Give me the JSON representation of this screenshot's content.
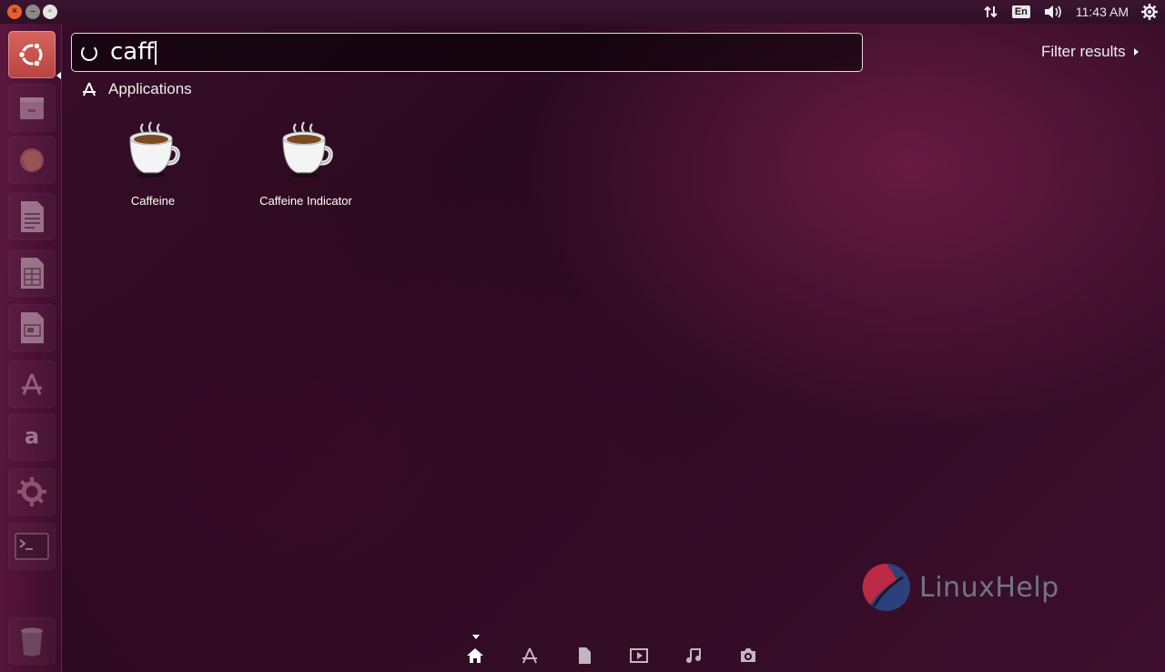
{
  "top_panel": {
    "keyboard_layout": "En",
    "clock": "11:43 AM",
    "window_buttons": [
      "close",
      "minimize",
      "maximize"
    ]
  },
  "launcher": {
    "items": [
      {
        "name": "ubuntu-dash",
        "icon": "ubuntu-logo-icon",
        "active": true
      },
      {
        "name": "files",
        "icon": "file-cabinet-icon"
      },
      {
        "name": "firefox",
        "icon": "firefox-icon"
      },
      {
        "name": "writer",
        "icon": "document-icon"
      },
      {
        "name": "calc",
        "icon": "spreadsheet-icon"
      },
      {
        "name": "impress",
        "icon": "presentation-icon"
      },
      {
        "name": "software-center",
        "icon": "software-center-icon"
      },
      {
        "name": "amazon",
        "icon": "amazon-icon"
      },
      {
        "name": "system-settings",
        "icon": "settings-icon"
      },
      {
        "name": "terminal",
        "icon": "terminal-icon"
      },
      {
        "name": "trash",
        "icon": "trash-icon"
      }
    ]
  },
  "search": {
    "query": "caff"
  },
  "filter": {
    "label": "Filter results"
  },
  "results": {
    "category": "Applications",
    "apps": [
      {
        "label": "Caffeine",
        "icon": "coffee-cup-icon"
      },
      {
        "label": "Caffeine Indicator",
        "icon": "coffee-cup-icon"
      }
    ]
  },
  "lenses": [
    "home-icon",
    "applications-icon",
    "files-icon",
    "video-icon",
    "music-icon",
    "photos-icon"
  ],
  "watermark": {
    "text": "LinuxHelp"
  },
  "colors": {
    "background": "#2a0a1f",
    "accent": "#dd4814",
    "launcher_active": "#c9524c"
  }
}
